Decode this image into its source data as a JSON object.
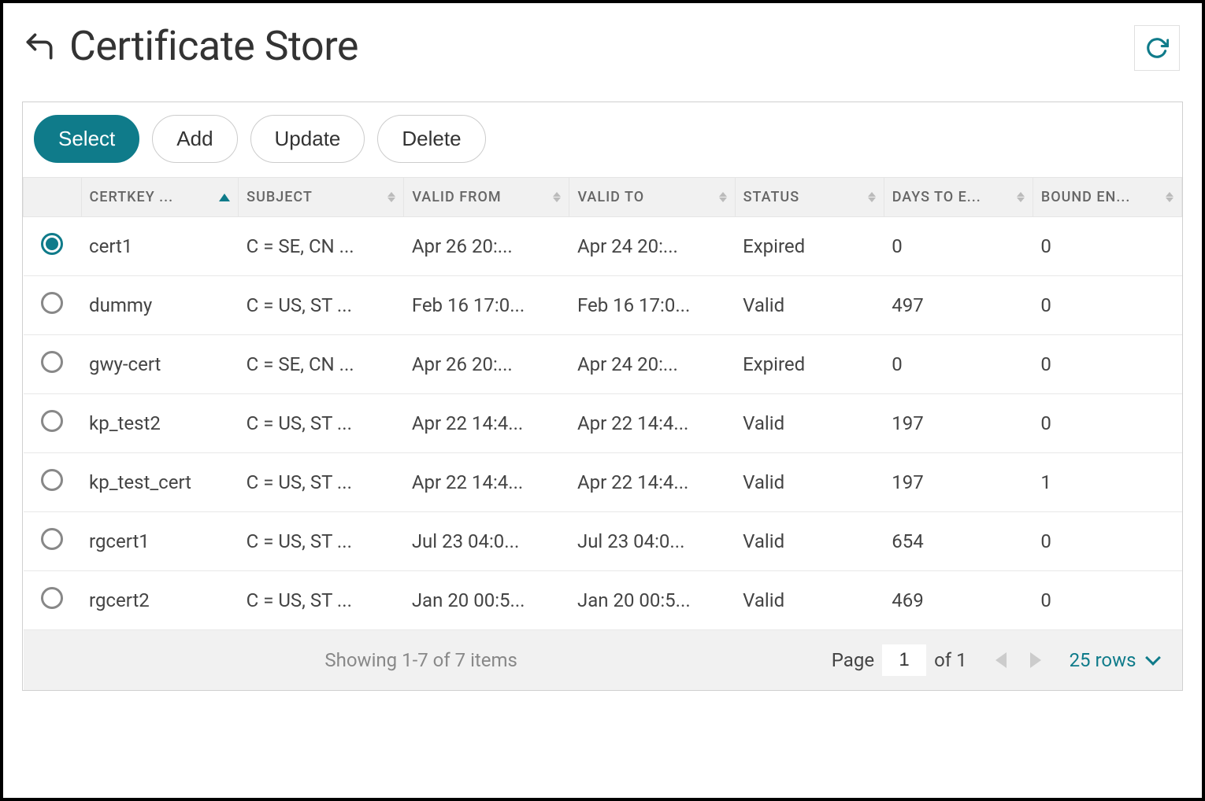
{
  "header": {
    "title": "Certificate Store"
  },
  "toolbar": {
    "select_label": "Select",
    "add_label": "Add",
    "update_label": "Update",
    "delete_label": "Delete"
  },
  "table": {
    "columns": {
      "certkey": "CERTKEY ...",
      "subject": "SUBJECT",
      "valid_from": "VALID FROM",
      "valid_to": "VALID TO",
      "status": "STATUS",
      "days": "DAYS TO E...",
      "bound": "BOUND EN..."
    },
    "rows": [
      {
        "selected": true,
        "certkey": "cert1",
        "subject": "C = SE, CN ...",
        "valid_from": "Apr 26 20:...",
        "valid_to": "Apr 24 20:...",
        "status": "Expired",
        "days": "0",
        "bound": "0"
      },
      {
        "selected": false,
        "certkey": "dummy",
        "subject": "C = US, ST ...",
        "valid_from": "Feb 16 17:0...",
        "valid_to": "Feb 16 17:0...",
        "status": "Valid",
        "days": "497",
        "bound": "0"
      },
      {
        "selected": false,
        "certkey": "gwy-cert",
        "subject": "C = SE, CN ...",
        "valid_from": "Apr 26 20:...",
        "valid_to": "Apr 24 20:...",
        "status": "Expired",
        "days": "0",
        "bound": "0"
      },
      {
        "selected": false,
        "certkey": "kp_test2",
        "subject": "C = US, ST ...",
        "valid_from": "Apr 22 14:4...",
        "valid_to": "Apr 22 14:4...",
        "status": "Valid",
        "days": "197",
        "bound": "0"
      },
      {
        "selected": false,
        "certkey": "kp_test_cert",
        "subject": "C = US, ST ...",
        "valid_from": "Apr 22 14:4...",
        "valid_to": "Apr 22 14:4...",
        "status": "Valid",
        "days": "197",
        "bound": "1"
      },
      {
        "selected": false,
        "certkey": "rgcert1",
        "subject": "C = US, ST ...",
        "valid_from": "Jul 23 04:0...",
        "valid_to": "Jul 23 04:0...",
        "status": "Valid",
        "days": "654",
        "bound": "0"
      },
      {
        "selected": false,
        "certkey": "rgcert2",
        "subject": "C = US, ST ...",
        "valid_from": "Jan 20 00:5...",
        "valid_to": "Jan 20 00:5...",
        "status": "Valid",
        "days": "469",
        "bound": "0"
      }
    ]
  },
  "footer": {
    "showing": "Showing 1-7 of 7 items",
    "page_label": "Page",
    "page_value": "1",
    "of_label": "of 1",
    "rows_label": "25 rows"
  }
}
